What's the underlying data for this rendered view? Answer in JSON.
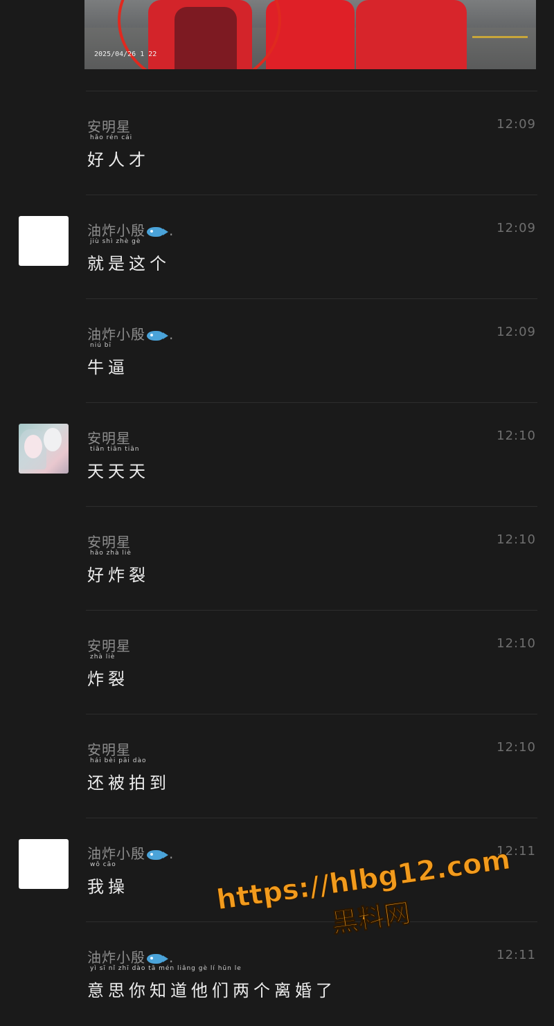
{
  "photo": {
    "timestamp": "2025/04/26 1  22"
  },
  "messages": [
    {
      "sender": "安明星",
      "fish": false,
      "time": "12:09",
      "pinyin": "hǎo  rén  cái",
      "text": "好人才",
      "avatar": "none"
    },
    {
      "sender": "油炸小殷",
      "fish": true,
      "time": "12:09",
      "pinyin": "jiù  shì  zhè  gè",
      "text": "就是这个",
      "avatar": "white"
    },
    {
      "sender": "油炸小殷",
      "fish": true,
      "time": "12:09",
      "pinyin": "niú  bī",
      "text": "牛逼",
      "avatar": "none"
    },
    {
      "sender": "安明星",
      "fish": false,
      "time": "12:10",
      "pinyin": "tiān  tiān  tiān",
      "text": "天天天",
      "avatar": "anime"
    },
    {
      "sender": "安明星",
      "fish": false,
      "time": "12:10",
      "pinyin": "hǎo  zhà  liè",
      "text": "好炸裂",
      "avatar": "none"
    },
    {
      "sender": "安明星",
      "fish": false,
      "time": "12:10",
      "pinyin": "zhà  liè",
      "text": "炸裂",
      "avatar": "none"
    },
    {
      "sender": "安明星",
      "fish": false,
      "time": "12:10",
      "pinyin": "hái  bèi  pāi  dào",
      "text": "还被拍到",
      "avatar": "none"
    },
    {
      "sender": "油炸小殷",
      "fish": true,
      "time": "12:11",
      "pinyin": "wǒ  cāo",
      "text": "我操",
      "avatar": "white"
    },
    {
      "sender": "油炸小殷",
      "fish": true,
      "time": "12:11",
      "pinyin": "yì  sī  nǐ  zhī  dào  tā  mén  liǎng  gè  lí  hūn  le",
      "text": "意思你知道他们两个离婚了",
      "avatar": "none"
    }
  ],
  "watermark": {
    "url": "https://hlbg12.com",
    "label": "黑料网"
  },
  "icons": {
    "fish": "fish-emoji-icon"
  },
  "colors": {
    "background": "#1a1a1a",
    "watermark": "#f29b1d",
    "circle": "#e0291f"
  }
}
